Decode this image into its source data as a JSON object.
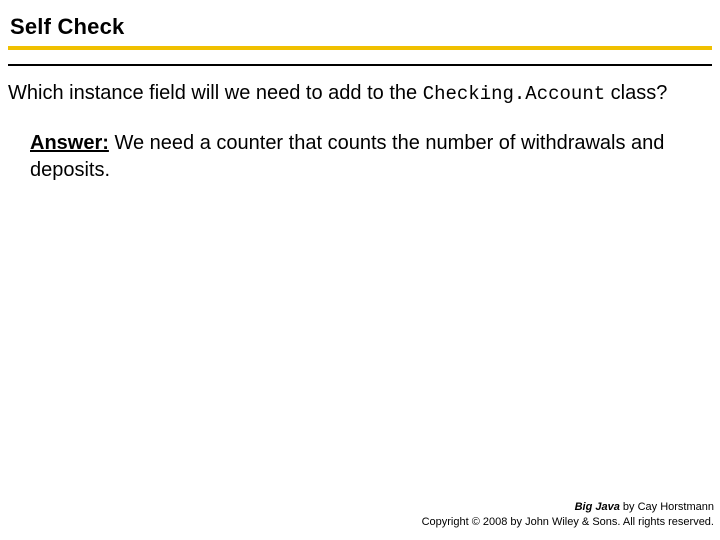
{
  "header": {
    "title": "Self Check"
  },
  "question": {
    "prefix": "Which instance field will we need to add to the ",
    "code": "Checking.Account",
    "suffix": " class?"
  },
  "answer": {
    "label": "Answer:",
    "text": " We need a counter that counts the number of withdrawals and deposits."
  },
  "footer": {
    "book_title": "Big Java",
    "byline": " by Cay Horstmann",
    "copyright": "Copyright © 2008 by John Wiley & Sons. All rights reserved."
  }
}
